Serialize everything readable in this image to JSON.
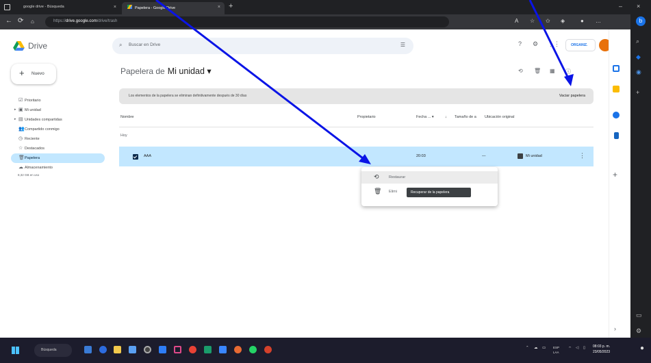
{
  "browser": {
    "tabs": [
      {
        "title": "google drive - Búsqueda"
      },
      {
        "title": "Papelera - Google Drive"
      }
    ],
    "url_prefix": "https://",
    "url_host": "drive.google.com",
    "url_path": "/drive/trash"
  },
  "app": {
    "name": "Drive",
    "search_placeholder": "Buscar en Drive",
    "org_chip": "ORGANIZ."
  },
  "sidebar": {
    "new_label": "Nuevo",
    "items": [
      {
        "label": "Prioritario",
        "icon": "checkbox-icon"
      },
      {
        "label": "Mi unidad",
        "icon": "my-drive-icon"
      },
      {
        "label": "Unidades compartidas",
        "icon": "shared-drives-icon"
      },
      {
        "label": "Compartido conmigo",
        "icon": "people-icon"
      },
      {
        "label": "Reciente",
        "icon": "clock-icon"
      },
      {
        "label": "Destacados",
        "icon": "star-icon"
      },
      {
        "label": "Papelera",
        "icon": "trash-icon"
      },
      {
        "label": "Almacenamiento",
        "icon": "cloud-icon"
      }
    ],
    "storage_text": "8,32 GB en uso"
  },
  "main": {
    "title": "Papelera de",
    "title_drive": "Mi unidad ▾",
    "banner_message": "Los elementos de la papelera se eliminan definitivamente después de 30 días",
    "empty_trash": "Vaciar papelera",
    "columns": {
      "name": "Nombre",
      "owner": "Propietario",
      "date": "Fecha ... ▾",
      "size": "Tamaño de a",
      "location": "Ubicación original"
    },
    "group_label": "Hoy",
    "row": {
      "name": "AAA",
      "date": "20:03",
      "size": "—",
      "location": "Mi unidad"
    }
  },
  "context_menu": {
    "items": [
      {
        "label": "Restaurar",
        "icon": "restore-icon"
      },
      {
        "label": "Elimi",
        "icon": "trash-icon"
      }
    ],
    "tooltip": "Recuperar de la papelera"
  },
  "taskbar": {
    "search": "Búsqueda",
    "lang": "ESP",
    "lang_sub": "LAA",
    "time": "08:03 p. m.",
    "date": "23/05/2023"
  },
  "colors": {
    "selected_row": "#c2e7ff",
    "annotation_arrow": "#0a14e6",
    "drive_green": "#0f9d58",
    "drive_yellow": "#fbbc04",
    "drive_blue": "#4285f4"
  }
}
